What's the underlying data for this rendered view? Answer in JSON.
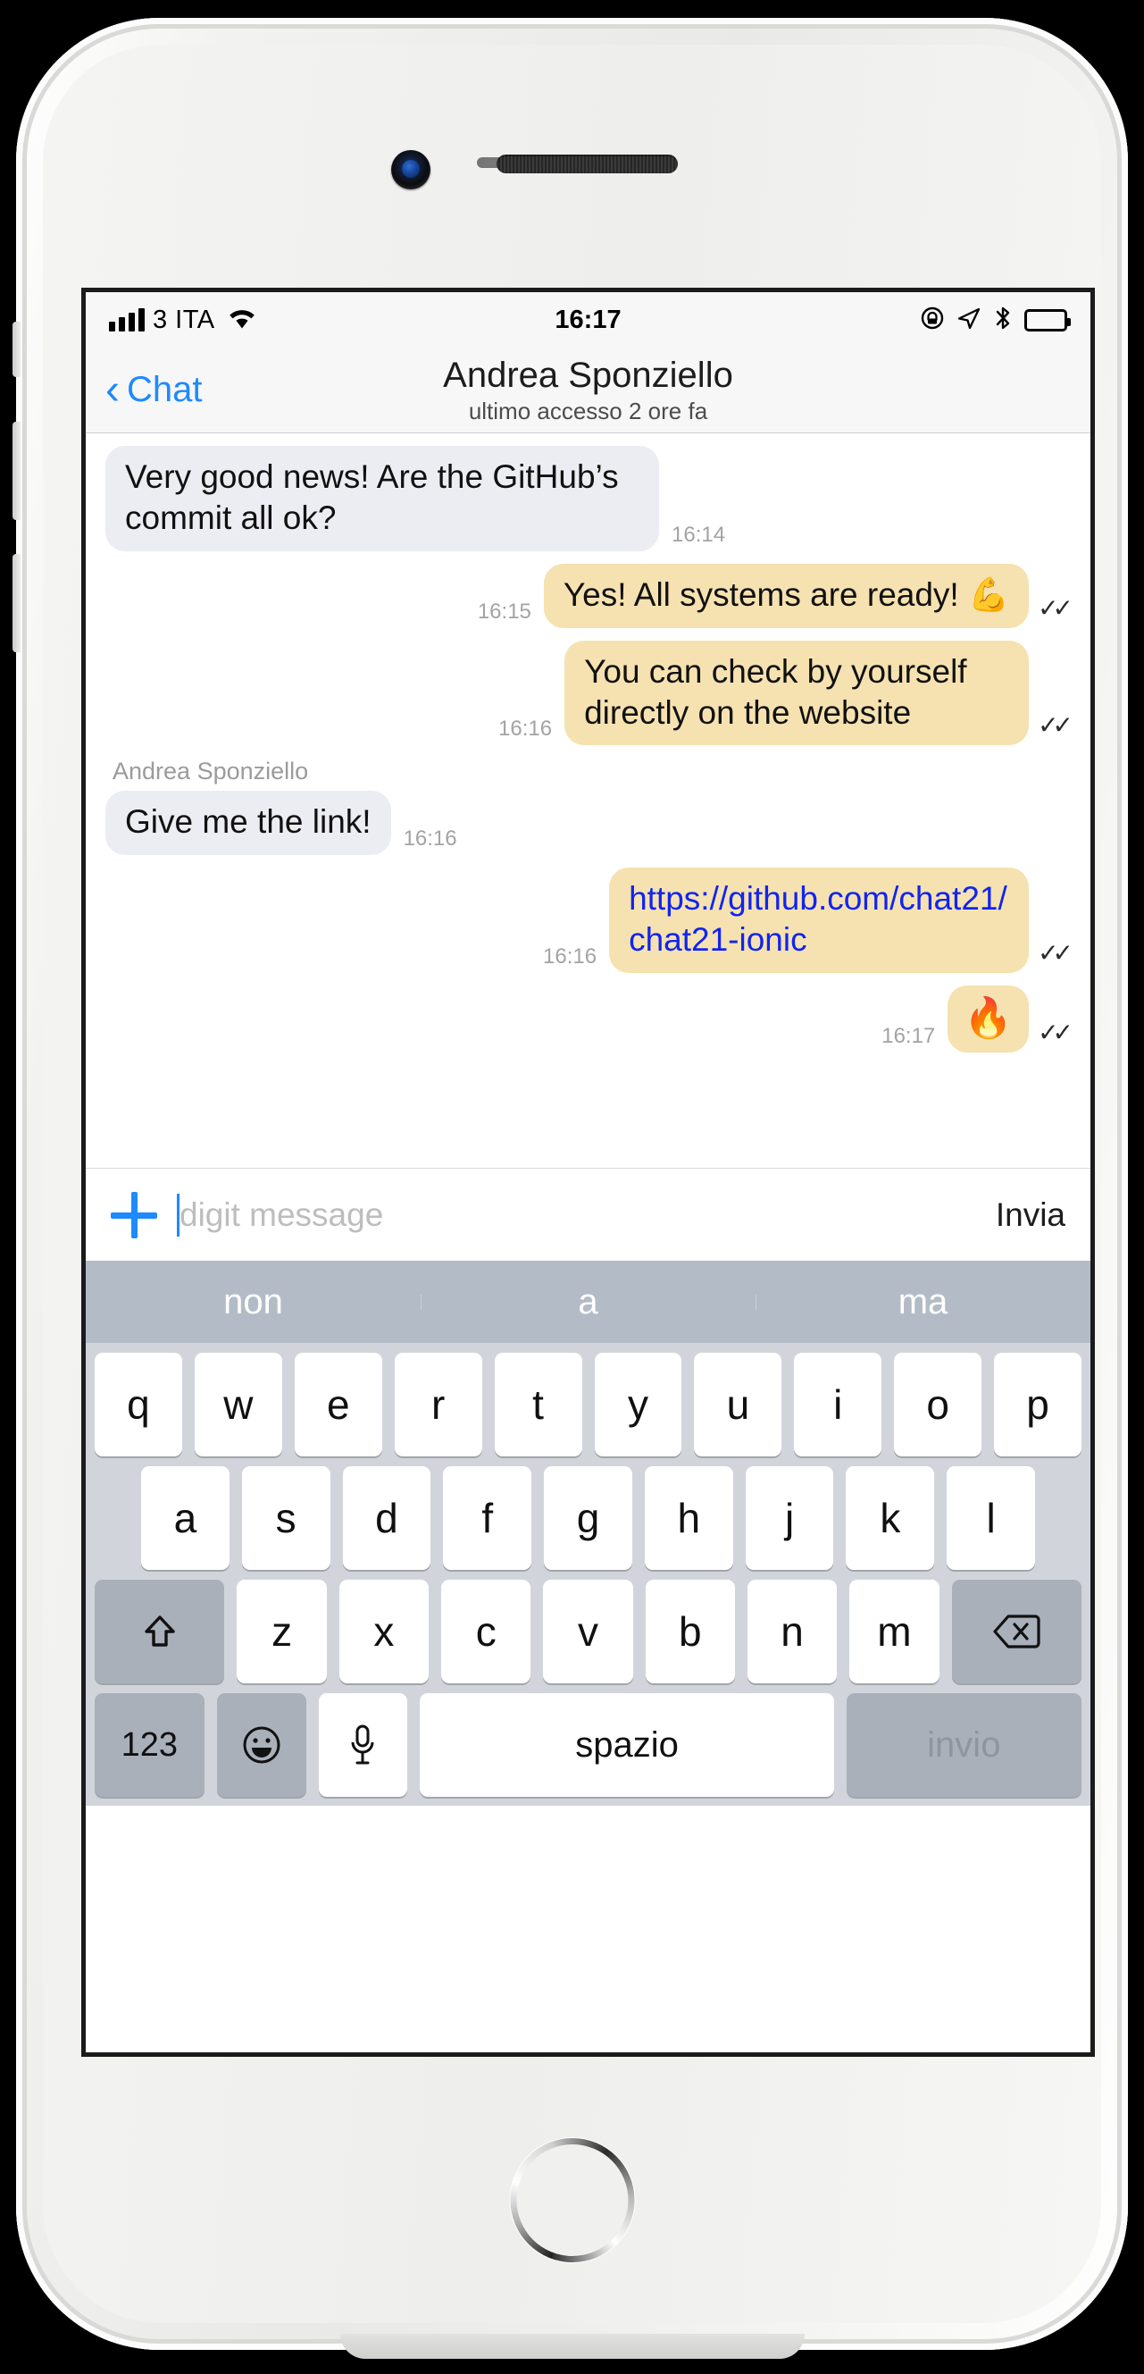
{
  "device": {
    "hardware": {
      "camera": "front-camera",
      "speaker": "earpiece-speaker",
      "home_button": "home-button"
    }
  },
  "statusbar": {
    "carrier": "3 ITA",
    "signal_bars": 4,
    "wifi_icon": "wifi-icon",
    "time": "16:17",
    "icons": [
      {
        "name": "rotation-lock-icon",
        "glyph": "ⓘ"
      },
      {
        "name": "location-arrow-icon",
        "glyph": "➤"
      },
      {
        "name": "bluetooth-icon",
        "glyph": "ᛦ"
      }
    ],
    "battery_label": "battery-full"
  },
  "navbar": {
    "back_label": "Chat",
    "back_icon": "chevron-left-icon",
    "title": "Andrea Sponziello",
    "subtitle": "ultimo accesso 2 ore fa"
  },
  "conversation": {
    "messages": [
      {
        "direction": "in",
        "text": "Very good news! Are the GitHub’s commit all ok?",
        "time": "16:14",
        "status": "",
        "sender": ""
      },
      {
        "direction": "out",
        "text": "Yes! All systems are ready! 💪",
        "time": "16:15",
        "status": "✓✓",
        "sender": ""
      },
      {
        "direction": "out",
        "text": "You can check by yourself directly on the website",
        "time": "16:16",
        "status": "✓✓",
        "sender": ""
      },
      {
        "direction": "in",
        "text": "Give me the link!",
        "time": "16:16",
        "status": "",
        "sender": "Andrea Sponziello"
      },
      {
        "direction": "out",
        "text": "https://github.com/chat21/chat21-ionic",
        "time": "16:16",
        "status": "✓✓",
        "sender": "",
        "is_link": true
      },
      {
        "direction": "out",
        "text": "🔥",
        "time": "16:17",
        "status": "✓✓",
        "sender": "",
        "emoji_only": true
      }
    ]
  },
  "inputbar": {
    "attach_icon": "plus-icon",
    "placeholder": "digit message",
    "value": "",
    "send_label": "Invia"
  },
  "keyboard": {
    "suggestions": [
      "non",
      "a",
      "ma"
    ],
    "row1": [
      "q",
      "w",
      "e",
      "r",
      "t",
      "y",
      "u",
      "i",
      "o",
      "p"
    ],
    "row2": [
      "a",
      "s",
      "d",
      "f",
      "g",
      "h",
      "j",
      "k",
      "l"
    ],
    "row3": [
      "z",
      "x",
      "c",
      "v",
      "b",
      "n",
      "m"
    ],
    "shift_icon": "shift-arrow-icon",
    "shift_glyph": "⇧",
    "backspace_icon": "backspace-icon",
    "backspace_glyph": "⌫",
    "numeric_label": "123",
    "emoji_icon": "emoji-smiley-icon",
    "emoji_glyph": "☺",
    "mic_icon": "microphone-icon",
    "mic_glyph": "⬤",
    "space_label": "spazio",
    "enter_label": "invio"
  },
  "colors": {
    "accent_blue": "#1d8aff",
    "bubble_in": "#ececf3",
    "bubble_out": "#f6e2b0",
    "link_blue": "#1024f0",
    "keyboard_bg": "#d1d5db",
    "suggest_bg": "#b3bcc6"
  }
}
